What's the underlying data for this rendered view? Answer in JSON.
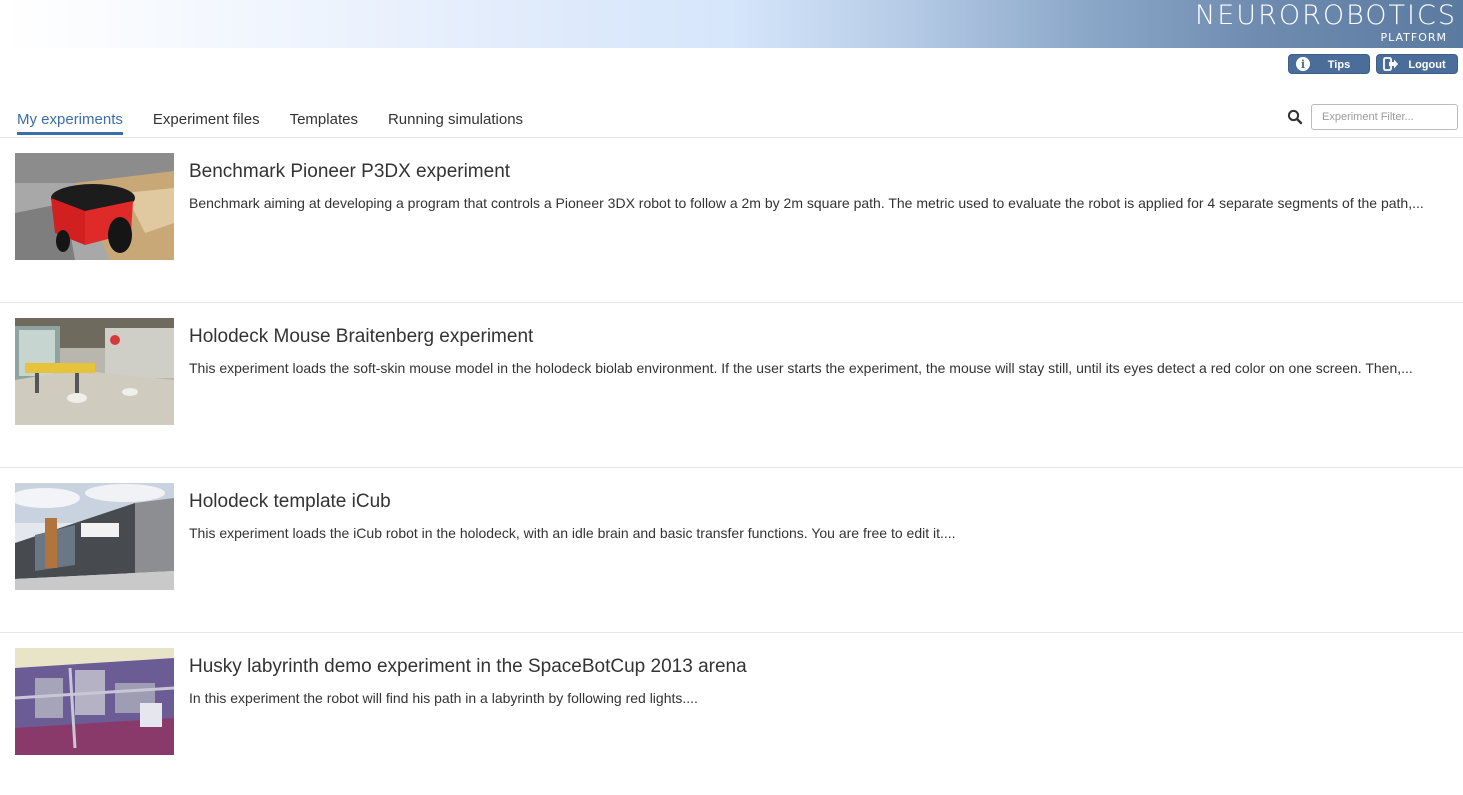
{
  "header": {
    "logo_main": "NEUROROBOTICS",
    "logo_sub": "PLATFORM"
  },
  "actions": {
    "tips_label": "Tips",
    "logout_label": "Logout"
  },
  "tabs": [
    {
      "label": "My experiments",
      "active": true
    },
    {
      "label": "Experiment files",
      "active": false
    },
    {
      "label": "Templates",
      "active": false
    },
    {
      "label": "Running simulations",
      "active": false
    }
  ],
  "search": {
    "placeholder": "Experiment Filter..."
  },
  "experiments": [
    {
      "title": "Benchmark Pioneer P3DX experiment",
      "description": "Benchmark aiming at developing a program that controls a Pioneer 3DX robot to follow a 2m by 2m square path. The metric used to evaluate the robot is applied for 4 separate segments of the path,..."
    },
    {
      "title": "Holodeck Mouse Braitenberg experiment",
      "description": "This experiment loads the soft-skin mouse model in the holodeck biolab environment. If the user starts the experiment, the mouse will stay still, until its eyes detect a red color on one screen. Then,..."
    },
    {
      "title": "Holodeck template iCub",
      "description": "This experiment loads the iCub robot in the holodeck, with an idle brain and basic transfer functions. You are free to edit it...."
    },
    {
      "title": "Husky labyrinth demo experiment in the SpaceBotCup 2013 arena",
      "description": "In this experiment the robot will find his path in a labyrinth by following red lights...."
    }
  ]
}
